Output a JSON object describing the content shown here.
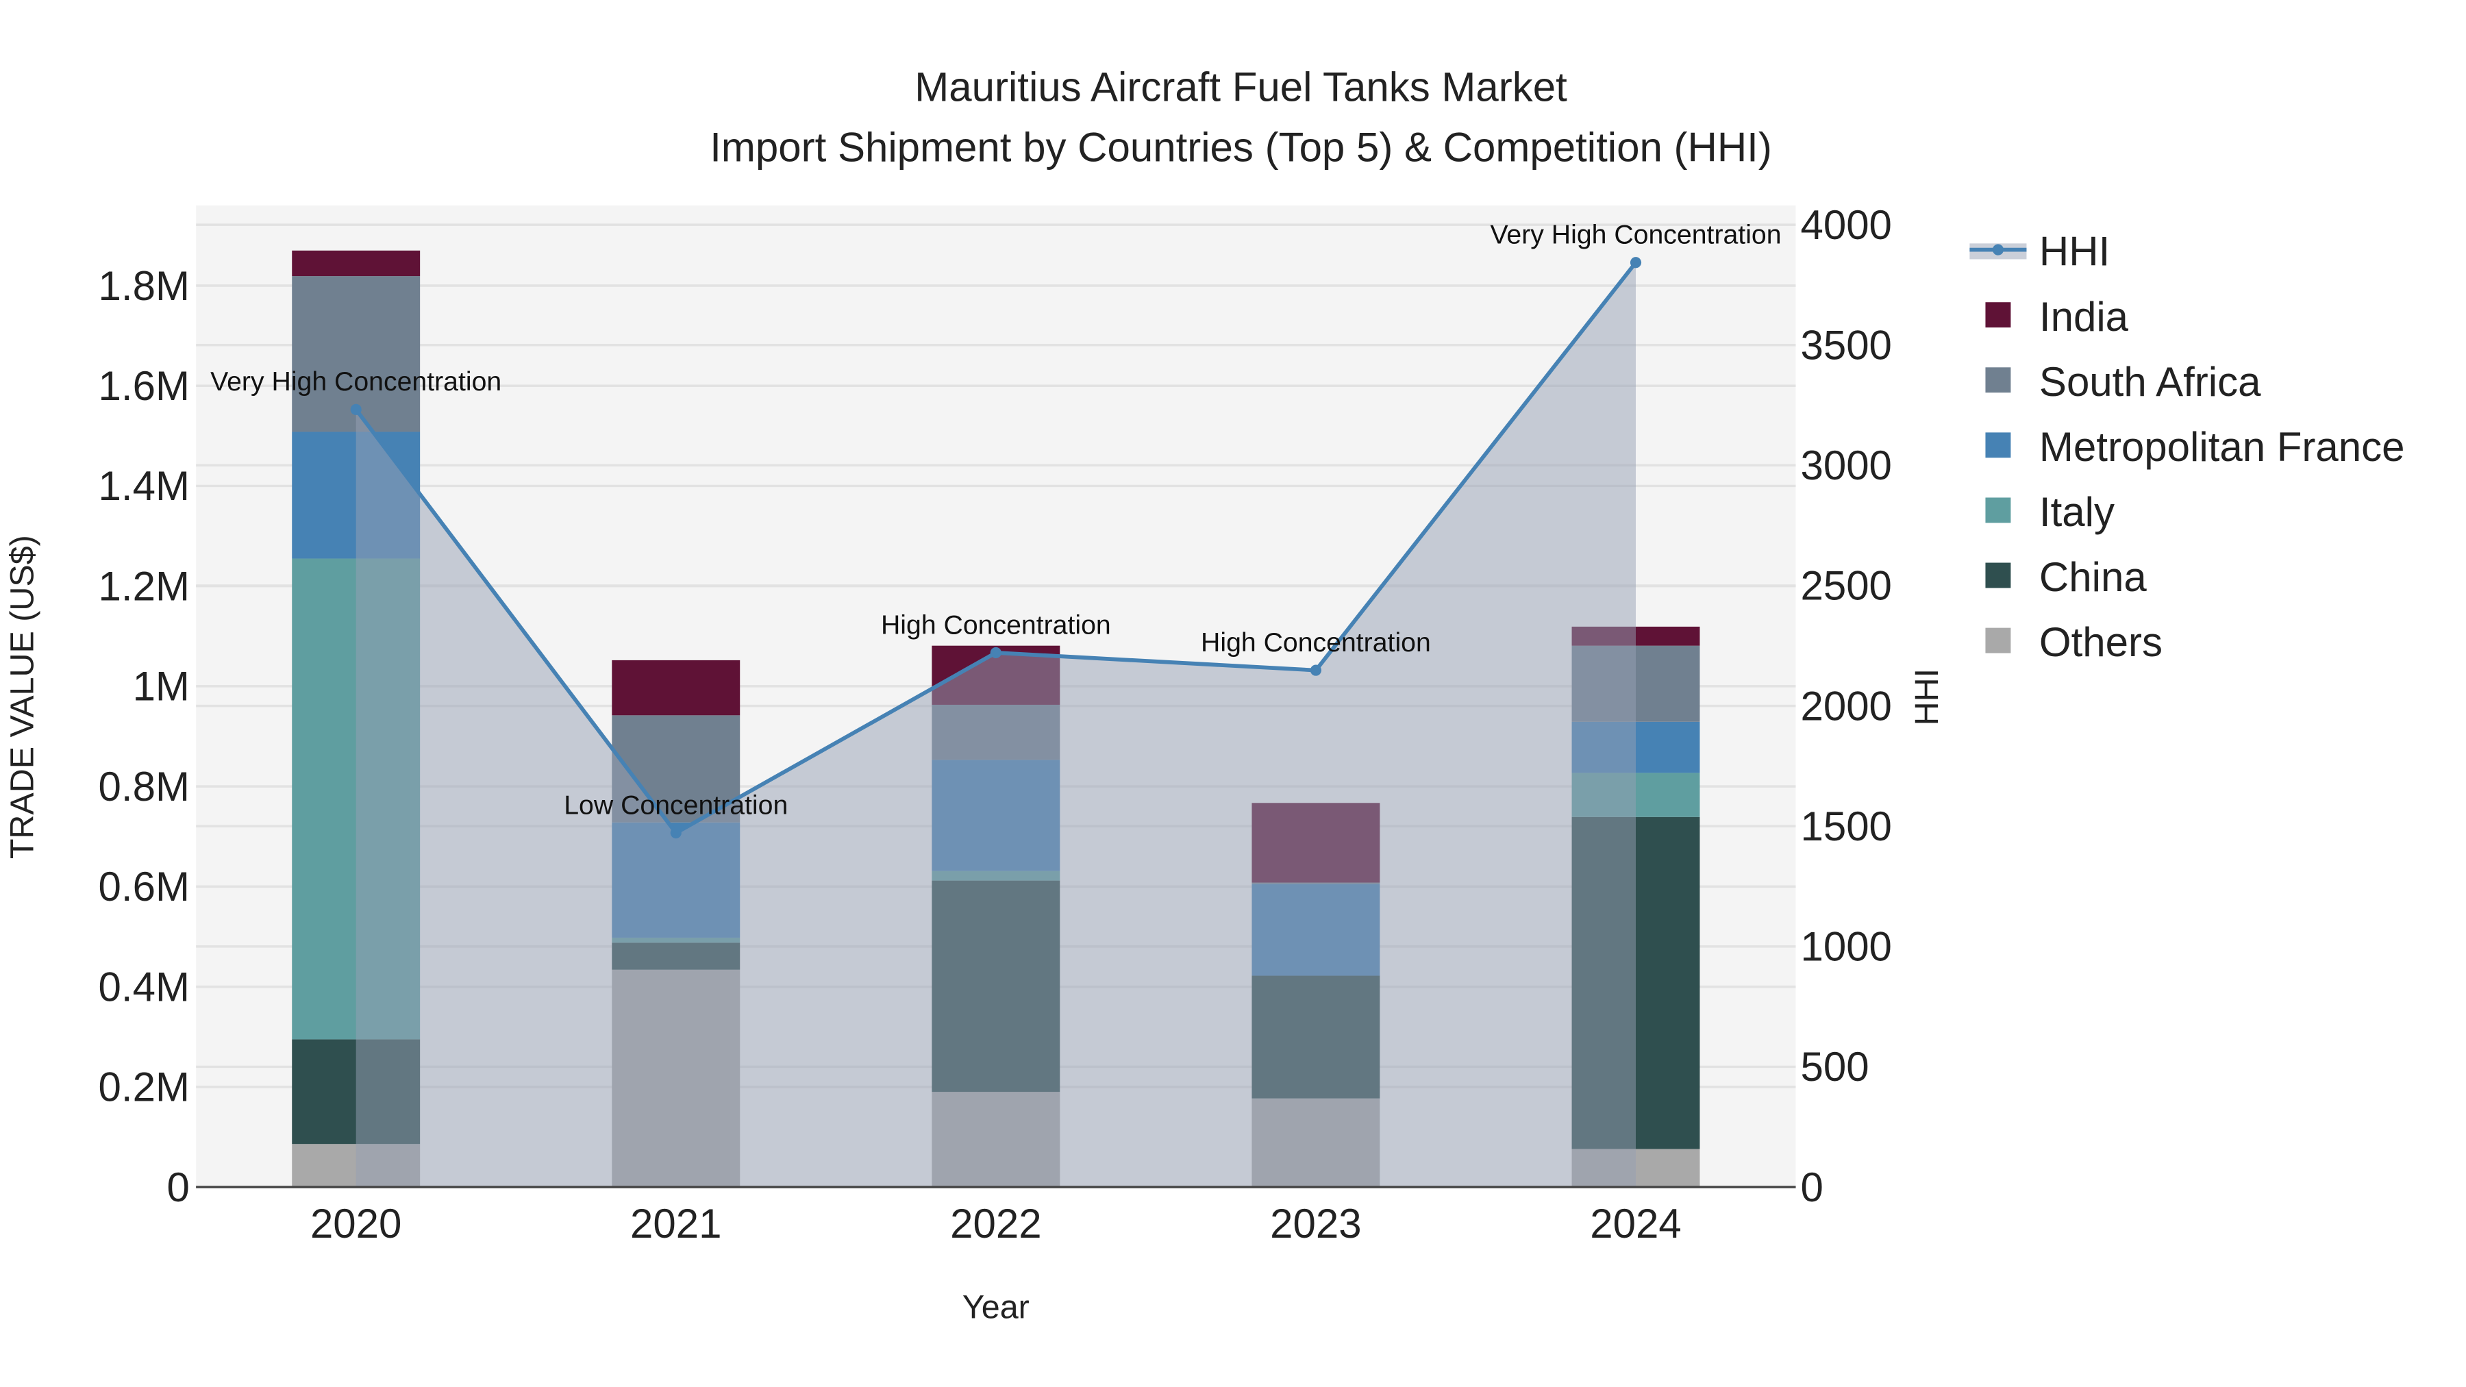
{
  "chart_data": {
    "type": "bar",
    "title": "Mauritius Aircraft Fuel Tanks Market",
    "subtitle": "Import Shipment by Countries (Top 5) & Competition (HHI)",
    "xlabel": "Year",
    "ylabel": "TRADE VALUE (US$)",
    "y2label": "HHI",
    "categories": [
      "2020",
      "2021",
      "2022",
      "2023",
      "2024"
    ],
    "ylim": [
      0,
      1960000
    ],
    "y2lim": [
      0,
      4080
    ],
    "yticks": [
      0,
      200000,
      400000,
      600000,
      800000,
      1000000,
      1200000,
      1400000,
      1600000,
      1800000
    ],
    "ytick_labels": [
      "0",
      "0.2M",
      "0.4M",
      "0.6M",
      "0.8M",
      "1M",
      "1.2M",
      "1.4M",
      "1.6M",
      "1.8M"
    ],
    "y2ticks": [
      0,
      500,
      1000,
      1500,
      2000,
      2500,
      3000,
      3500,
      4000
    ],
    "y2tick_labels": [
      "0",
      "500",
      "1000",
      "1500",
      "2000",
      "2500",
      "3000",
      "3500",
      "4000"
    ],
    "grid": true,
    "legend_position": "right",
    "series": [
      {
        "name": "Others",
        "color": "#a9a9a9",
        "values": [
          86000,
          434000,
          190000,
          177000,
          76000
        ]
      },
      {
        "name": "China",
        "color": "#2f4f4f",
        "values": [
          209000,
          54000,
          422000,
          245000,
          663000
        ]
      },
      {
        "name": "Italy",
        "color": "#5f9ea0",
        "values": [
          960000,
          10000,
          19000,
          0,
          88000
        ]
      },
      {
        "name": "Metropolitan France",
        "color": "#4682b4",
        "values": [
          253000,
          230000,
          222000,
          183000,
          102000
        ]
      },
      {
        "name": "South Africa",
        "color": "#708090",
        "values": [
          311000,
          214000,
          110000,
          3000,
          152000
        ]
      },
      {
        "name": "India",
        "color": "#5f1236",
        "values": [
          51000,
          110000,
          118000,
          159000,
          38000
        ]
      }
    ],
    "hhi": {
      "name": "HHI",
      "color": "#4682b4",
      "values": [
        3232,
        1472,
        2221,
        2148,
        3843
      ],
      "annotations": [
        "Very High Concentration",
        "Low Concentration",
        "High Concentration",
        "High Concentration",
        "Very High Concentration"
      ]
    },
    "legend_order": [
      "HHI",
      "India",
      "South Africa",
      "Metropolitan France",
      "Italy",
      "China",
      "Others"
    ]
  }
}
